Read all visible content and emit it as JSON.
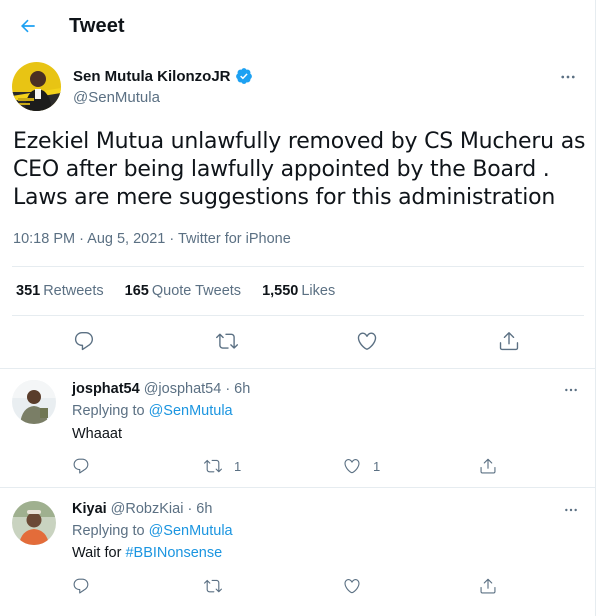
{
  "header": {
    "title": "Tweet",
    "back_icon": "arrow-left-icon"
  },
  "tweet": {
    "author_name": "Sen Mutula KilonzoJR",
    "author_handle": "@SenMutula",
    "verified": true,
    "text": "Ezekiel Mutua unlawfully removed by CS Mucheru  as CEO after being lawfully appointed by the Board . Laws are mere suggestions for this administration",
    "meta": "10:18 PM · Aug 5, 2021 · Twitter for iPhone",
    "stats": {
      "retweets_count": "351",
      "retweets_label": "Retweets",
      "quotes_count": "165",
      "quotes_label": "Quote Tweets",
      "likes_count": "1,550",
      "likes_label": "Likes"
    }
  },
  "replies": [
    {
      "name": "josphat54",
      "handle": "@josphat54 · 6h",
      "replying_label": "Replying to",
      "replying_to": "@SenMutula",
      "text": "Whaaat",
      "retweet_count": "1",
      "like_count": "1"
    },
    {
      "name": "Kiyai",
      "handle": "@RobzKiai · 6h",
      "replying_label": "Replying to",
      "replying_to": "@SenMutula",
      "text_prefix": "Wait for",
      "hashtag": "#BBINonsense",
      "retweet_count": "",
      "like_count": ""
    }
  ],
  "colors": {
    "accent": "#1da1f2",
    "link": "#1b95e0",
    "secondary_text": "#5b7083",
    "divider": "#e6ecf0"
  }
}
